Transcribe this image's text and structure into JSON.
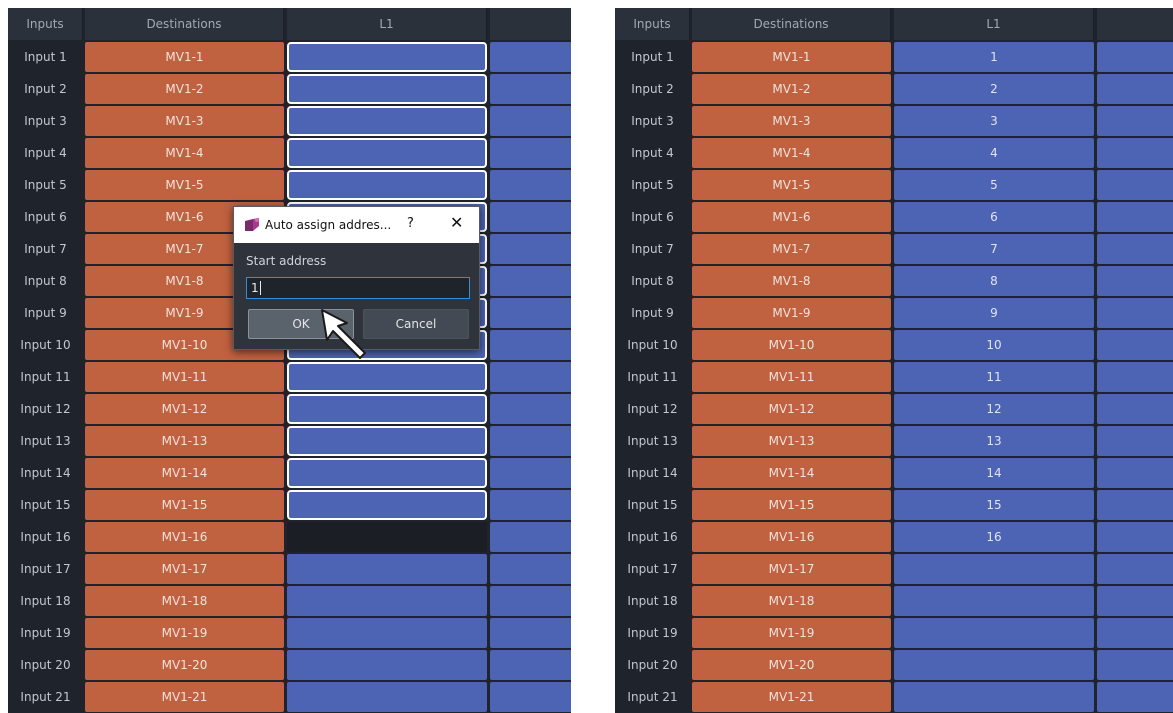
{
  "headers": {
    "inputs": "Inputs",
    "destinations": "Destinations",
    "l1": "L1"
  },
  "left_rows": [
    {
      "input": "Input 1",
      "dest": "MV1-1",
      "l1": ""
    },
    {
      "input": "Input 2",
      "dest": "MV1-2",
      "l1": ""
    },
    {
      "input": "Input 3",
      "dest": "MV1-3",
      "l1": ""
    },
    {
      "input": "Input 4",
      "dest": "MV1-4",
      "l1": ""
    },
    {
      "input": "Input 5",
      "dest": "MV1-5",
      "l1": ""
    },
    {
      "input": "Input 6",
      "dest": "MV1-6",
      "l1": ""
    },
    {
      "input": "Input 7",
      "dest": "MV1-7",
      "l1": ""
    },
    {
      "input": "Input 8",
      "dest": "MV1-8",
      "l1": ""
    },
    {
      "input": "Input 9",
      "dest": "MV1-9",
      "l1": ""
    },
    {
      "input": "Input 10",
      "dest": "MV1-10",
      "l1": ""
    },
    {
      "input": "Input 11",
      "dest": "MV1-11",
      "l1": ""
    },
    {
      "input": "Input 12",
      "dest": "MV1-12",
      "l1": ""
    },
    {
      "input": "Input 13",
      "dest": "MV1-13",
      "l1": ""
    },
    {
      "input": "Input 14",
      "dest": "MV1-14",
      "l1": ""
    },
    {
      "input": "Input 15",
      "dest": "MV1-15",
      "l1": ""
    },
    {
      "input": "Input 16",
      "dest": "MV1-16",
      "l1": ""
    },
    {
      "input": "Input 17",
      "dest": "MV1-17",
      "l1": ""
    },
    {
      "input": "Input 18",
      "dest": "MV1-18",
      "l1": ""
    },
    {
      "input": "Input 19",
      "dest": "MV1-19",
      "l1": ""
    },
    {
      "input": "Input 20",
      "dest": "MV1-20",
      "l1": ""
    },
    {
      "input": "Input 21",
      "dest": "MV1-21",
      "l1": ""
    }
  ],
  "right_rows": [
    {
      "input": "Input 1",
      "dest": "MV1-1",
      "l1": "1"
    },
    {
      "input": "Input 2",
      "dest": "MV1-2",
      "l1": "2"
    },
    {
      "input": "Input 3",
      "dest": "MV1-3",
      "l1": "3"
    },
    {
      "input": "Input 4",
      "dest": "MV1-4",
      "l1": "4"
    },
    {
      "input": "Input 5",
      "dest": "MV1-5",
      "l1": "5"
    },
    {
      "input": "Input 6",
      "dest": "MV1-6",
      "l1": "6"
    },
    {
      "input": "Input 7",
      "dest": "MV1-7",
      "l1": "7"
    },
    {
      "input": "Input 8",
      "dest": "MV1-8",
      "l1": "8"
    },
    {
      "input": "Input 9",
      "dest": "MV1-9",
      "l1": "9"
    },
    {
      "input": "Input 10",
      "dest": "MV1-10",
      "l1": "10"
    },
    {
      "input": "Input 11",
      "dest": "MV1-11",
      "l1": "11"
    },
    {
      "input": "Input 12",
      "dest": "MV1-12",
      "l1": "12"
    },
    {
      "input": "Input 13",
      "dest": "MV1-13",
      "l1": "13"
    },
    {
      "input": "Input 14",
      "dest": "MV1-14",
      "l1": "14"
    },
    {
      "input": "Input 15",
      "dest": "MV1-15",
      "l1": "15"
    },
    {
      "input": "Input 16",
      "dest": "MV1-16",
      "l1": "16"
    },
    {
      "input": "Input 17",
      "dest": "MV1-17",
      "l1": ""
    },
    {
      "input": "Input 18",
      "dest": "MV1-18",
      "l1": ""
    },
    {
      "input": "Input 19",
      "dest": "MV1-19",
      "l1": ""
    },
    {
      "input": "Input 20",
      "dest": "MV1-20",
      "l1": ""
    },
    {
      "input": "Input 21",
      "dest": "MV1-21",
      "l1": ""
    }
  ],
  "dialog": {
    "title": "Auto assign addres...",
    "help": "?",
    "close": "✕",
    "label": "Start address",
    "value": "1",
    "ok": "OK",
    "cancel": "Cancel"
  },
  "colors": {
    "destination": "#c0613f",
    "level": "#4d63b3",
    "background": "#1e232c",
    "header": "#2b313b"
  }
}
